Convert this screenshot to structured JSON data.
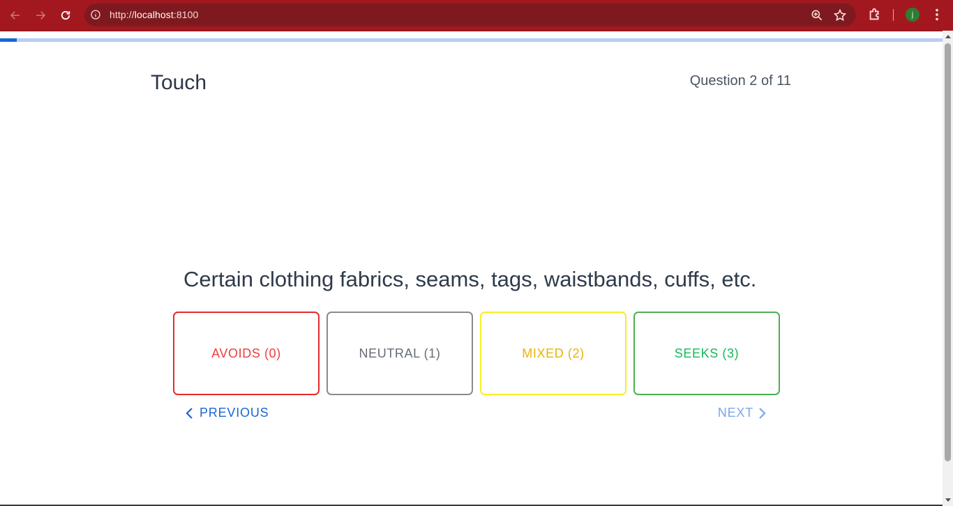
{
  "browser": {
    "url_scheme": "http://",
    "url_host": "localhost",
    "url_port": ":8100",
    "avatar_letter": "j",
    "theme_color": "#a3181f"
  },
  "progress": {
    "current": 2,
    "total": 11,
    "fill_fraction": 0.018,
    "fill_color": "#1a66d9",
    "track_color": "#b8cdf3"
  },
  "page": {
    "category_title": "Touch",
    "question_counter": "Question 2 of 11",
    "question_text": "Certain clothing fabrics, seams, tags, waistbands, cuffs, etc."
  },
  "answers": [
    {
      "label": "AVOIDS (0)",
      "border_color": "#e32b2b",
      "text_color": "#ef3d3d"
    },
    {
      "label": "NEUTRAL (1)",
      "border_color": "#8a8a8a",
      "text_color": "#666c75"
    },
    {
      "label": "MIXED (2)",
      "border_color": "#f7ee2a",
      "text_color": "#eab308"
    },
    {
      "label": "SEEKS (3)",
      "border_color": "#4caf50",
      "text_color": "#16b85a"
    }
  ],
  "navigation": {
    "previous_label": "PREVIOUS",
    "next_label": "NEXT"
  },
  "icons": {
    "back": "arrow-left-icon",
    "forward": "arrow-right-icon",
    "reload": "reload-icon",
    "site_info": "info-icon",
    "zoom": "zoom-icon",
    "bookmark": "star-icon",
    "extensions": "puzzle-icon",
    "menu": "kebab-menu-icon"
  }
}
